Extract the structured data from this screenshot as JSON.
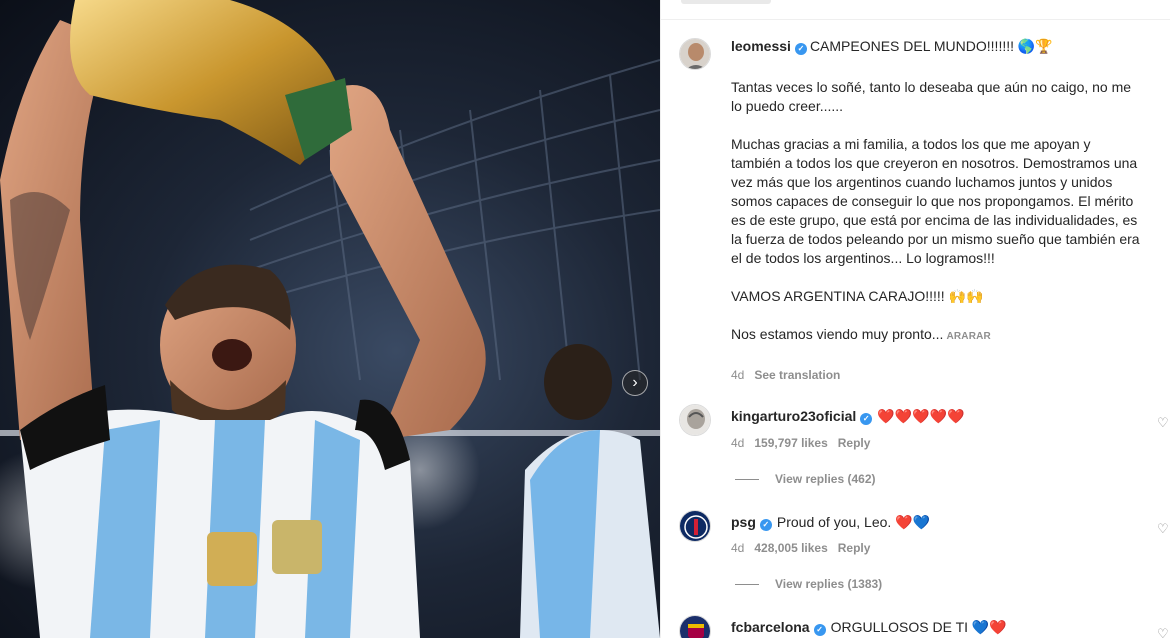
{
  "post": {
    "author": "leomessi",
    "headline": "CAMPEONES DEL MUNDO!!!!!!! 🌎🏆",
    "paragraphs": [
      "Tantas veces lo soñé, tanto lo deseaba que aún no caigo, no me lo puedo creer......",
      "Muchas gracias a mi familia, a todos los que me apoyan y también a todos los que creyeron en nosotros. Demostramos una vez más que los argentinos cuando luchamos juntos y unidos somos capaces de conseguir lo que nos propongamos. El mérito es de este grupo, que está por encima de las individualidades, es la fuerza de todos peleando por un mismo sueño que también era el de todos los argentinos... Lo logramos!!!",
      "VAMOS ARGENTINA CARAJO!!!!! 🙌🙌"
    ],
    "last_line": "Nos estamos viendo muy pronto...",
    "more_label": "ARARAR",
    "age": "4d",
    "see_translation": "See translation"
  },
  "comments": [
    {
      "user": "kingarturo23oficial",
      "text": "❤️❤️❤️❤️❤️",
      "age": "4d",
      "likes": "159,797 likes",
      "reply": "Reply",
      "view_replies": "View replies (462)"
    },
    {
      "user": "psg",
      "text": "Proud of you, Leo. ❤️💙",
      "age": "4d",
      "likes": "428,005 likes",
      "reply": "Reply",
      "view_replies": "View replies (1383)"
    },
    {
      "user": "fcbarcelona",
      "text": "ORGULLOSOS DE TI 💙❤️"
    }
  ],
  "icons": {
    "verified": "verified-badge-icon",
    "like": "heart-outline-icon",
    "carousel_next": "chevron-right-icon"
  },
  "colors": {
    "verified_blue": "#3897f0",
    "muted_text": "#8e8e8e",
    "heart_red": "#ed2f3c"
  }
}
